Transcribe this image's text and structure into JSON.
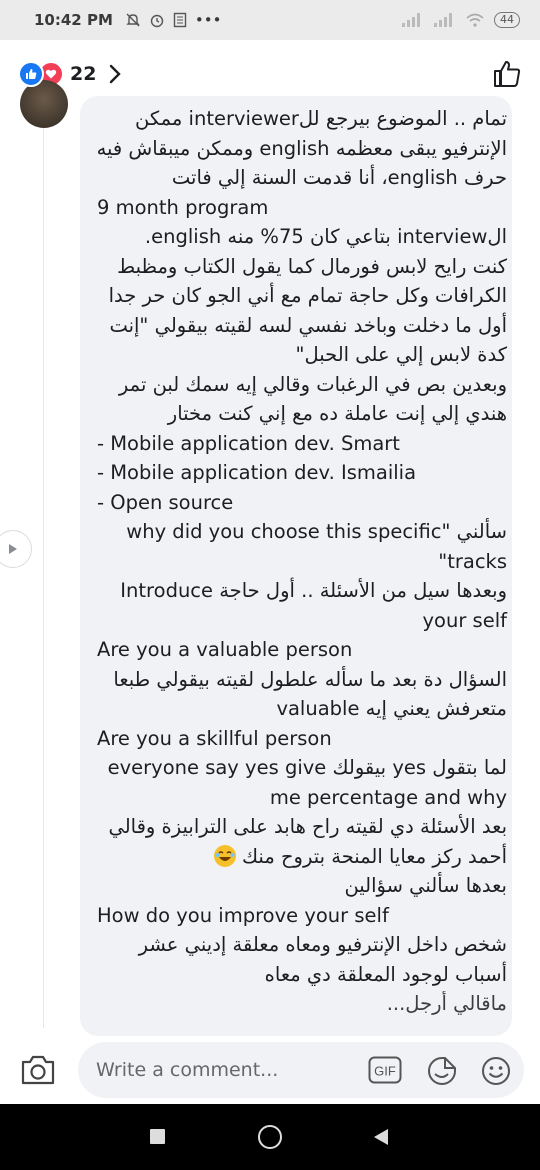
{
  "status_bar": {
    "time": "10:42 PM",
    "more": "•••",
    "battery": "44"
  },
  "header": {
    "reaction_count": "22"
  },
  "comment": {
    "lines": [
      "تمام .. الموضوع بيرجع للinterviewer ممكن",
      "الإنترفيو يبقى معظمه english وممكن ميبقاش فيه",
      "حرف english، أنا قدمت السنة إلي فاتت",
      "9 month program",
      "الinterview بتاعي كان 75% منه english.",
      "كنت رايح لابس فورمال كما يقول الكتاب ومظبط",
      "الكرافات وكل حاجة تمام مع أني الجو كان حر جدا",
      "أول ما دخلت وباخد نفسي لسه لقيته بيقولي \"إنت",
      "كدة لابس إلي على الحبل\"",
      "وبعدين بص في الرغبات وقالي إيه سمك لبن تمر",
      "هندي إلي إنت عاملة ده مع إني كنت مختار",
      "- Mobile application dev. Smart",
      "- Mobile application dev. Ismailia",
      "- Open source",
      "سألني \"why did you choose this specific",
      "tracks\"",
      "وبعدها سيل من الأسئلة .. أول حاجة Introduce",
      "your self",
      "Are you a valuable person",
      "السؤال دة بعد ما سأله علطول لقيته بيقولي طبعا",
      "متعرفش يعني إيه valuable",
      "Are you a skillful person",
      "لما بتقول yes بيقولك everyone say yes give",
      "me percentage and why",
      "بعد الأسئلة دي لقيته راح هابد على الترابيزة وقالي",
      "أحمد ركز معايا المنحة بتروح منك",
      "بعدها سألني سؤالين",
      "How do you improve your self",
      "شخص داخل الإنترفيو ومعاه معلقة إديني عشر",
      "أسباب لوجود المعلقة دي معاه",
      "ماقالي أرجل..."
    ]
  },
  "composer": {
    "placeholder": "Write a comment...",
    "gif_label": "GIF"
  },
  "icons": {
    "status": [
      "mute-icon",
      "alarm-icon",
      "notes-icon",
      "signal-icon",
      "wifi-icon",
      "battery-icon"
    ],
    "header": [
      "like-reaction-icon",
      "love-reaction-icon",
      "chevron-right-icon",
      "thumbs-up-icon"
    ],
    "composer": [
      "camera-icon",
      "gif-icon",
      "sticker-icon",
      "emoji-icon"
    ],
    "nav": [
      "nav-back-icon",
      "nav-home-icon",
      "nav-recent-icon"
    ]
  },
  "colors": {
    "accent": "#1877f2",
    "love": "#f33e58",
    "bubble": "#f0f2f5"
  }
}
